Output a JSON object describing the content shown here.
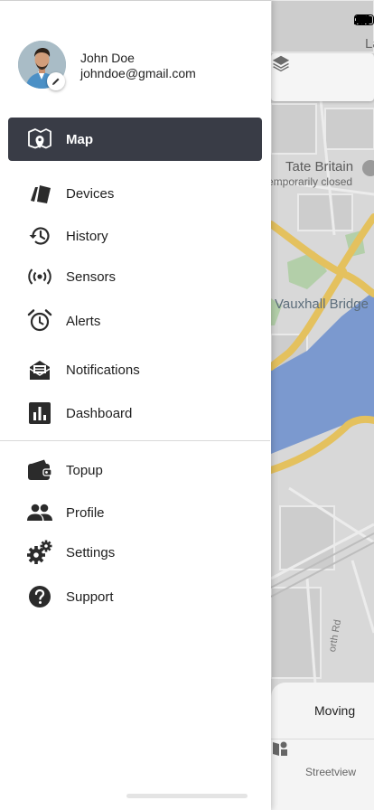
{
  "status_bar": {
    "icons": [
      "signal-icon",
      "wifi-icon",
      "battery-icon"
    ]
  },
  "map": {
    "labels": {
      "tate": "Tate Britain",
      "tate_status": "emporarily closed",
      "vauxhall": "Vauxhall Bridge",
      "partial_top": "La",
      "road": "orth Rd"
    },
    "layers_icon": "layers-icon",
    "status_card": {
      "label": "Moving"
    },
    "bottom_nav": {
      "streetview_label": "Streetview",
      "streetview_icon": "streetview-icon"
    },
    "colors": {
      "road": "#e4c15e",
      "water": "#7b99cf",
      "park": "#b3cfa9",
      "land": "#d8d8d8"
    }
  },
  "drawer": {
    "user": {
      "name": "John Doe",
      "email": "johndoe@gmail.com",
      "edit_icon": "pencil-icon"
    },
    "items": [
      {
        "label": "Map",
        "icon": "map-icon",
        "active": true
      },
      {
        "label": "Devices",
        "icon": "devices-icon"
      },
      {
        "label": "History",
        "icon": "history-icon"
      },
      {
        "label": "Sensors",
        "icon": "sensors-icon"
      },
      {
        "label": "Alerts",
        "icon": "alarm-clock-icon"
      },
      {
        "label": "Notifications",
        "icon": "notifications-icon"
      },
      {
        "label": "Dashboard",
        "icon": "dashboard-icon"
      }
    ],
    "secondary_items": [
      {
        "label": "Topup",
        "icon": "wallet-icon"
      },
      {
        "label": "Profile",
        "icon": "people-icon"
      },
      {
        "label": "Settings",
        "icon": "gears-icon"
      },
      {
        "label": "Support",
        "icon": "help-icon"
      }
    ],
    "colors": {
      "active_bg": "#393c46",
      "active_text": "#ffffff",
      "text": "#1e1e1e",
      "icon": "#2b2b2b"
    }
  }
}
